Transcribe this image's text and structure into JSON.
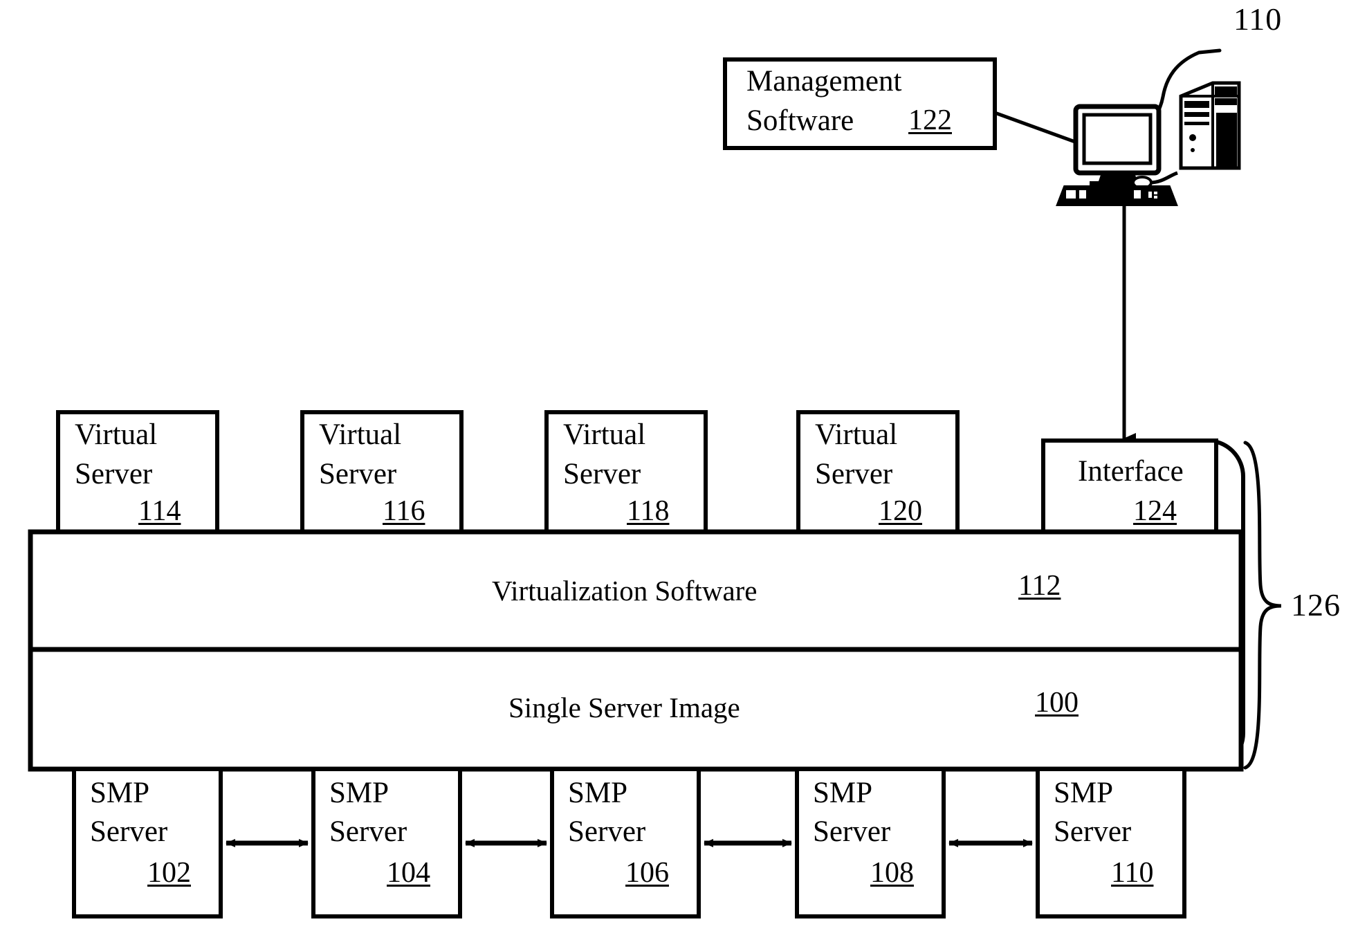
{
  "figure": {
    "top_ref": "110",
    "bracket_ref": "126"
  },
  "management": {
    "line1": "Management",
    "line2": "Software",
    "ref": "122"
  },
  "workstation": {
    "name": "computer-workstation"
  },
  "virtual_servers": [
    {
      "line1": "Virtual",
      "line2": "Server",
      "ref": "114"
    },
    {
      "line1": "Virtual",
      "line2": "Server",
      "ref": "116"
    },
    {
      "line1": "Virtual",
      "line2": "Server",
      "ref": "118"
    },
    {
      "line1": "Virtual",
      "line2": "Server",
      "ref": "120"
    }
  ],
  "interface_box": {
    "label": "Interface",
    "ref": "124"
  },
  "layers": [
    {
      "label": "Virtualization Software",
      "ref": "112"
    },
    {
      "label": "Single Server Image",
      "ref": "100"
    }
  ],
  "smp_servers": [
    {
      "line1": "SMP",
      "line2": "Server",
      "ref": "102"
    },
    {
      "line1": "SMP",
      "line2": "Server",
      "ref": "104"
    },
    {
      "line1": "SMP",
      "line2": "Server",
      "ref": "106"
    },
    {
      "line1": "SMP",
      "line2": "Server",
      "ref": "108"
    },
    {
      "line1": "SMP",
      "line2": "Server",
      "ref": "110"
    }
  ]
}
